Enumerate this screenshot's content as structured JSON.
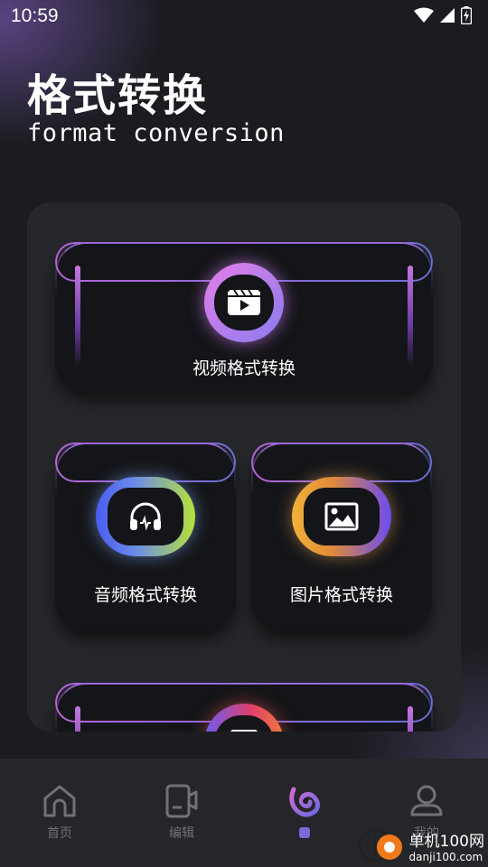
{
  "status": {
    "time": "10:59"
  },
  "header": {
    "title": "格式转换",
    "subtitle": "format conversion"
  },
  "cards": {
    "video": {
      "label": "视频格式转换",
      "icon": "clapperboard-icon"
    },
    "audio": {
      "label": "音频格式转换",
      "icon": "headphones-icon"
    },
    "image": {
      "label": "图片格式转换",
      "icon": "image-icon"
    }
  },
  "nav": {
    "items": [
      {
        "label": "首页",
        "icon": "home-icon"
      },
      {
        "label": "编辑",
        "icon": "video-camera-icon"
      },
      {
        "label": "",
        "icon": "swirl-logo-icon"
      },
      {
        "label": "我的",
        "icon": "profile-icon"
      }
    ],
    "active_index": 2
  },
  "watermark": {
    "line1": "单机100网",
    "line2": "danji100.com"
  },
  "colors": {
    "accent_purple": "#b565d8",
    "accent_blue": "#6a6fd6",
    "nav_inactive": "#707278",
    "active_dot": "#7a6ad8"
  }
}
